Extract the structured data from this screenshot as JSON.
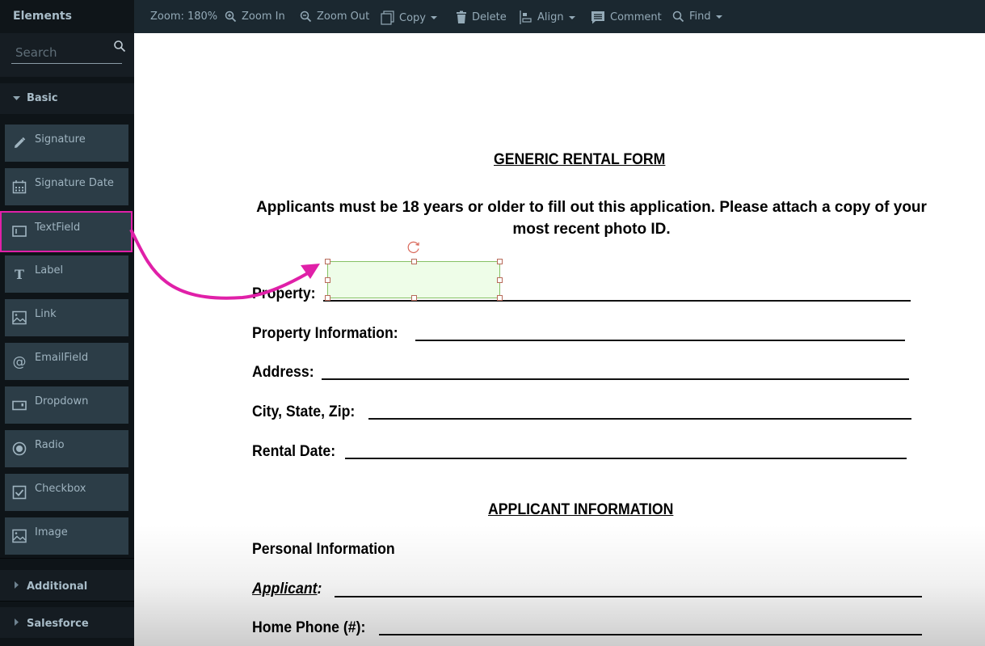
{
  "sidebar": {
    "title": "Elements",
    "search": {
      "placeholder": "Search",
      "value": ""
    },
    "sections": [
      {
        "label": "Basic",
        "expanded": true
      },
      {
        "label": "Additional",
        "expanded": false
      },
      {
        "label": "Salesforce",
        "expanded": false
      }
    ],
    "items": [
      {
        "label": "Signature",
        "icon": "pencil-icon"
      },
      {
        "label": "Signature Date",
        "icon": "calendar-icon"
      },
      {
        "label": "TextField",
        "icon": "textfield-icon",
        "highlighted": true
      },
      {
        "label": "Label",
        "icon": "text-t-icon"
      },
      {
        "label": "Link",
        "icon": "image-icon"
      },
      {
        "label": "EmailField",
        "icon": "at-icon"
      },
      {
        "label": "Dropdown",
        "icon": "dropdown-icon"
      },
      {
        "label": "Radio",
        "icon": "radio-icon"
      },
      {
        "label": "Checkbox",
        "icon": "checkbox-icon"
      },
      {
        "label": "Image",
        "icon": "image-icon"
      }
    ]
  },
  "toolbar": {
    "zoom_label": "Zoom: 180%",
    "zoom_in": "Zoom In",
    "zoom_out": "Zoom Out",
    "copy": "Copy",
    "delete": "Delete",
    "align": "Align",
    "comment": "Comment",
    "find": "Find"
  },
  "document": {
    "title": "GENERIC  RENTAL FORM",
    "intro": "Applicants must be 18 years or older to fill out this application. Please attach a copy of your most recent photo ID.",
    "fields": [
      {
        "label": "Property:"
      },
      {
        "label": "Property Information:"
      },
      {
        "label": "Address:"
      },
      {
        "label": "City, State, Zip:"
      },
      {
        "label": "Rental Date:"
      }
    ],
    "section2_title": "APPLICANT INFORMATION",
    "personal_info": "Personal Information",
    "applicant_label": "Applicant",
    "applicant_colon": ":",
    "home_phone": "Home Phone (#):"
  },
  "colors": {
    "highlight": "#e020a8",
    "field_fill": "#eefde8",
    "field_border": "#86c265"
  }
}
